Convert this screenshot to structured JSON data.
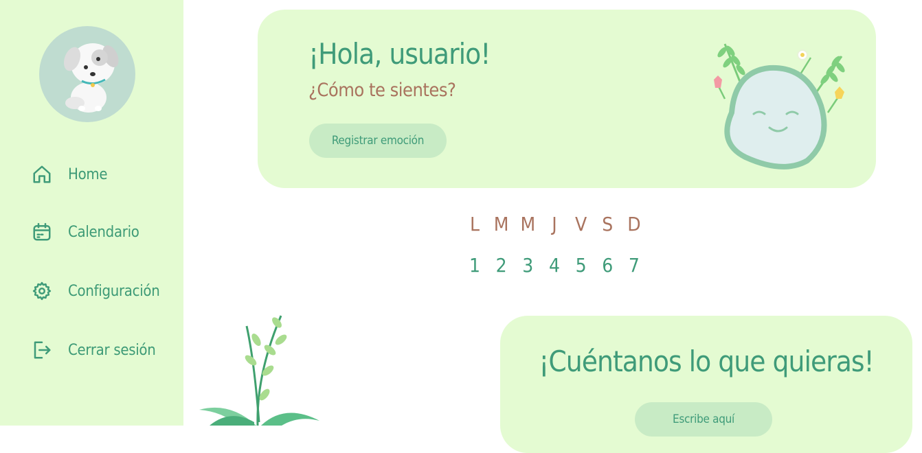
{
  "sidebar": {
    "items": [
      {
        "label": "Home",
        "icon": "home-icon"
      },
      {
        "label": "Calendario",
        "icon": "calendar-icon"
      },
      {
        "label": "Configuración",
        "icon": "gear-icon"
      },
      {
        "label": "Cerrar sesión",
        "icon": "logout-icon"
      }
    ]
  },
  "greeting": {
    "title": "¡Hola, usuario!",
    "subtitle": "¿Cómo te sientes?",
    "button_label": "Registrar emoción"
  },
  "week": {
    "days": [
      "L",
      "M",
      "M",
      "J",
      "V",
      "S",
      "D"
    ],
    "numbers": [
      "1",
      "2",
      "3",
      "4",
      "5",
      "6",
      "7"
    ]
  },
  "tell": {
    "title": "¡Cuéntanos lo que quieras!",
    "button_label": "Escribe aquí"
  },
  "colors": {
    "sidebar_bg": "#e4fbd2",
    "accent_green": "#3f9b79",
    "accent_brown": "#a9735e",
    "button_bg": "#c8ebc5"
  }
}
